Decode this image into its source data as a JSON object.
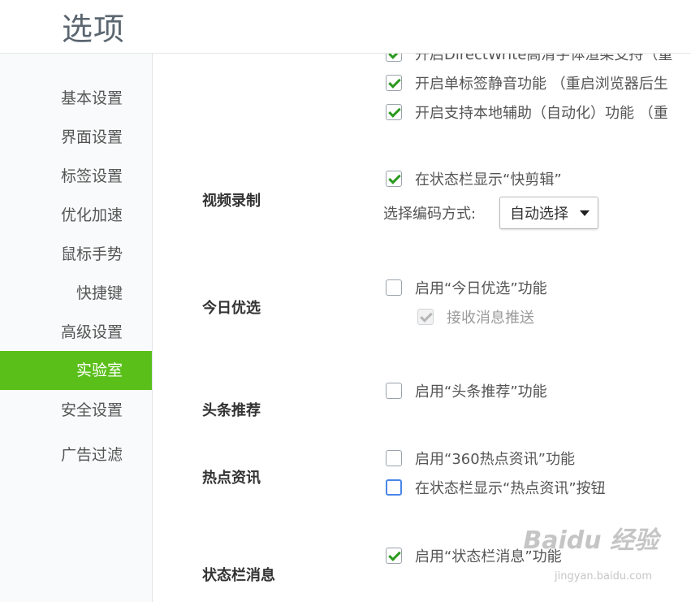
{
  "header": {
    "title": "选项"
  },
  "sidebar": {
    "items": [
      {
        "label": "基本设置"
      },
      {
        "label": "界面设置"
      },
      {
        "label": "标签设置"
      },
      {
        "label": "优化加速"
      },
      {
        "label": "鼠标手势"
      },
      {
        "label": "快捷键"
      },
      {
        "label": "高级设置"
      },
      {
        "label": "实验室",
        "active": true
      },
      {
        "label": "安全设置"
      },
      {
        "label": "广告过滤"
      }
    ]
  },
  "content": {
    "top_options": [
      {
        "label": "开启DirectWrite高清字体渲染支持（重",
        "checked": true
      },
      {
        "label": "开启单标签静音功能 （重启浏览器后生",
        "checked": true
      },
      {
        "label": "开启支持本地辅助（自动化）功能 （重",
        "checked": true
      }
    ],
    "video": {
      "label": "视频录制",
      "option": {
        "label": "在状态栏显示“快剪辑”",
        "checked": true
      },
      "encode_label": "选择编码方式:",
      "encode_value": "自动选择"
    },
    "today": {
      "label": "今日优选",
      "option": {
        "label": "启用“今日优选”功能",
        "checked": false
      },
      "sub_option": {
        "label": "接收消息推送",
        "checked": true,
        "disabled": true
      }
    },
    "headline": {
      "label": "头条推荐",
      "option": {
        "label": "启用“头条推荐”功能",
        "checked": false
      }
    },
    "hot": {
      "label": "热点资讯",
      "option1": {
        "label": "启用“360热点资讯”功能",
        "checked": false
      },
      "option2": {
        "label": "在状态栏显示“热点资讯”按钮",
        "checked": false
      }
    },
    "statusbar": {
      "label": "状态栏消息",
      "option": {
        "label": "启用“状态栏消息”功能",
        "checked": true
      }
    }
  },
  "watermark": {
    "main": "Baidu 经验",
    "sub": "jingyan.baidu.com"
  }
}
